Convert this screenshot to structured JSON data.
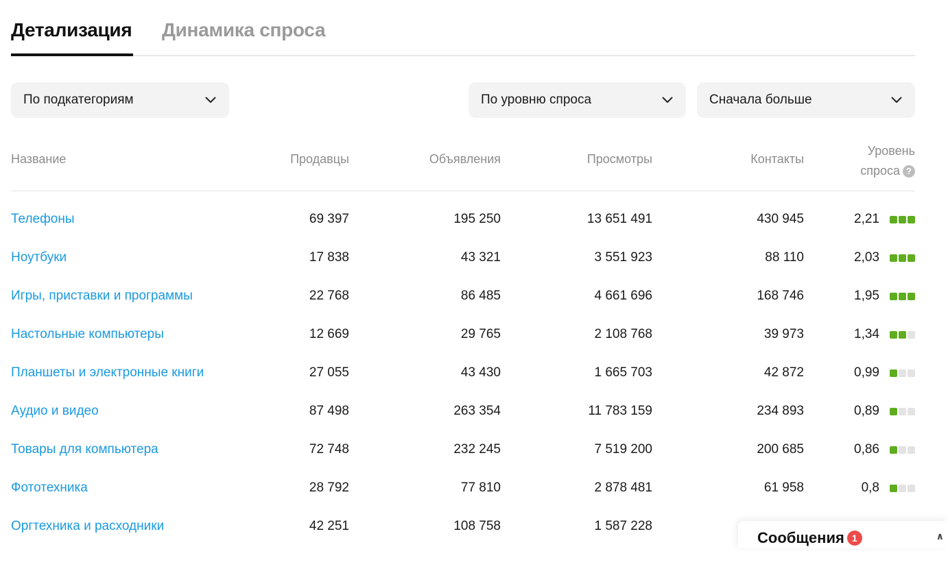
{
  "tabs": [
    {
      "label": "Детализация",
      "active": true
    },
    {
      "label": "Динамика спроса",
      "active": false
    }
  ],
  "filters": {
    "grouping": "По подкатегориям",
    "sort_by": "По уровню спроса",
    "order": "Сначала больше"
  },
  "table": {
    "headers": {
      "name": "Название",
      "sellers": "Продавцы",
      "ads": "Объявления",
      "views": "Просмотры",
      "contacts": "Контакты",
      "demand_line1": "Уровень",
      "demand_line2": "спроса"
    },
    "rows": [
      {
        "name": "Телефоны",
        "sellers": "69 397",
        "ads": "195 250",
        "views": "13 651 491",
        "contacts": "430 945",
        "level": "2,21",
        "bars": 3
      },
      {
        "name": "Ноутбуки",
        "sellers": "17 838",
        "ads": "43 321",
        "views": "3 551 923",
        "contacts": "88 110",
        "level": "2,03",
        "bars": 3
      },
      {
        "name": "Игры, приставки и программы",
        "sellers": "22 768",
        "ads": "86 485",
        "views": "4 661 696",
        "contacts": "168 746",
        "level": "1,95",
        "bars": 3
      },
      {
        "name": "Настольные компьютеры",
        "sellers": "12 669",
        "ads": "29 765",
        "views": "2 108 768",
        "contacts": "39 973",
        "level": "1,34",
        "bars": 2
      },
      {
        "name": "Планшеты и электронные книги",
        "sellers": "27 055",
        "ads": "43 430",
        "views": "1 665 703",
        "contacts": "42 872",
        "level": "0,99",
        "bars": 1
      },
      {
        "name": "Аудио и видео",
        "sellers": "87 498",
        "ads": "263 354",
        "views": "11 783 159",
        "contacts": "234 893",
        "level": "0,89",
        "bars": 1
      },
      {
        "name": "Товары для компьютера",
        "sellers": "72 748",
        "ads": "232 245",
        "views": "7 519 200",
        "contacts": "200 685",
        "level": "0,86",
        "bars": 1
      },
      {
        "name": "Фототехника",
        "sellers": "28 792",
        "ads": "77 810",
        "views": "2 878 481",
        "contacts": "61 958",
        "level": "0,8",
        "bars": 1
      },
      {
        "name": "Оргтехника и расходники",
        "sellers": "42 251",
        "ads": "108 758",
        "views": "1 587 228",
        "contacts": "",
        "level": "",
        "bars": 0
      }
    ]
  },
  "messages": {
    "label": "Сообщения",
    "count": "1"
  },
  "colors": {
    "link": "#1a9ae0",
    "bar_on": "#5fad1f",
    "bar_off": "#e3e3e3",
    "badge": "#ee4b4b"
  }
}
